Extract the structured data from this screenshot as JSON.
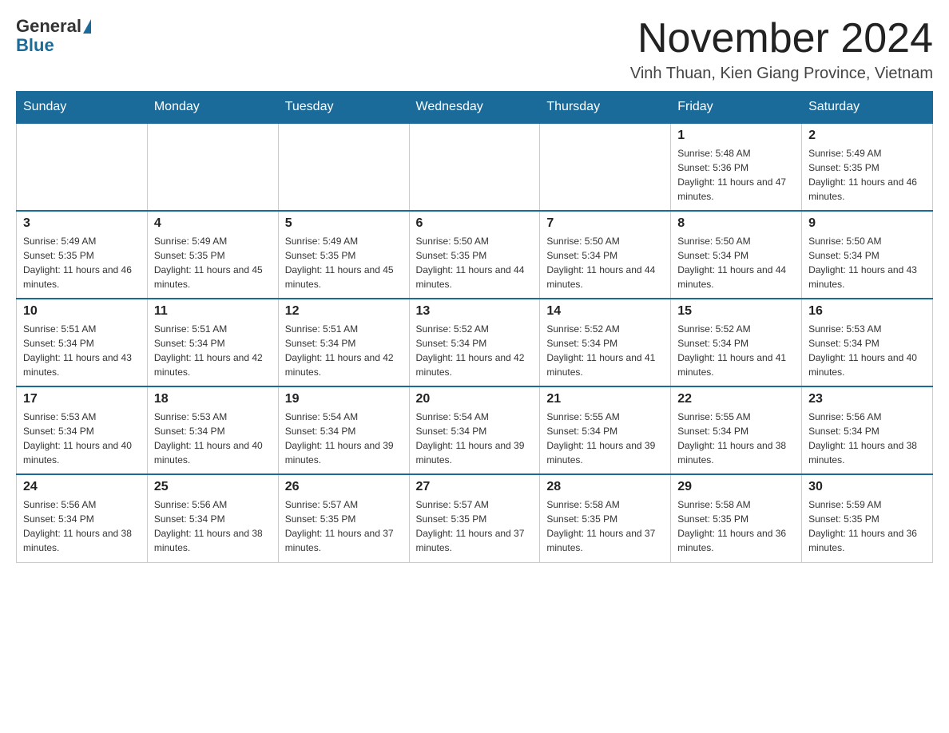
{
  "header": {
    "logo_general": "General",
    "logo_blue": "Blue",
    "title": "November 2024",
    "subtitle": "Vinh Thuan, Kien Giang Province, Vietnam"
  },
  "days_of_week": [
    "Sunday",
    "Monday",
    "Tuesday",
    "Wednesday",
    "Thursday",
    "Friday",
    "Saturday"
  ],
  "weeks": [
    [
      {
        "day": "",
        "info": ""
      },
      {
        "day": "",
        "info": ""
      },
      {
        "day": "",
        "info": ""
      },
      {
        "day": "",
        "info": ""
      },
      {
        "day": "",
        "info": ""
      },
      {
        "day": "1",
        "info": "Sunrise: 5:48 AM\nSunset: 5:36 PM\nDaylight: 11 hours and 47 minutes."
      },
      {
        "day": "2",
        "info": "Sunrise: 5:49 AM\nSunset: 5:35 PM\nDaylight: 11 hours and 46 minutes."
      }
    ],
    [
      {
        "day": "3",
        "info": "Sunrise: 5:49 AM\nSunset: 5:35 PM\nDaylight: 11 hours and 46 minutes."
      },
      {
        "day": "4",
        "info": "Sunrise: 5:49 AM\nSunset: 5:35 PM\nDaylight: 11 hours and 45 minutes."
      },
      {
        "day": "5",
        "info": "Sunrise: 5:49 AM\nSunset: 5:35 PM\nDaylight: 11 hours and 45 minutes."
      },
      {
        "day": "6",
        "info": "Sunrise: 5:50 AM\nSunset: 5:35 PM\nDaylight: 11 hours and 44 minutes."
      },
      {
        "day": "7",
        "info": "Sunrise: 5:50 AM\nSunset: 5:34 PM\nDaylight: 11 hours and 44 minutes."
      },
      {
        "day": "8",
        "info": "Sunrise: 5:50 AM\nSunset: 5:34 PM\nDaylight: 11 hours and 44 minutes."
      },
      {
        "day": "9",
        "info": "Sunrise: 5:50 AM\nSunset: 5:34 PM\nDaylight: 11 hours and 43 minutes."
      }
    ],
    [
      {
        "day": "10",
        "info": "Sunrise: 5:51 AM\nSunset: 5:34 PM\nDaylight: 11 hours and 43 minutes."
      },
      {
        "day": "11",
        "info": "Sunrise: 5:51 AM\nSunset: 5:34 PM\nDaylight: 11 hours and 42 minutes."
      },
      {
        "day": "12",
        "info": "Sunrise: 5:51 AM\nSunset: 5:34 PM\nDaylight: 11 hours and 42 minutes."
      },
      {
        "day": "13",
        "info": "Sunrise: 5:52 AM\nSunset: 5:34 PM\nDaylight: 11 hours and 42 minutes."
      },
      {
        "day": "14",
        "info": "Sunrise: 5:52 AM\nSunset: 5:34 PM\nDaylight: 11 hours and 41 minutes."
      },
      {
        "day": "15",
        "info": "Sunrise: 5:52 AM\nSunset: 5:34 PM\nDaylight: 11 hours and 41 minutes."
      },
      {
        "day": "16",
        "info": "Sunrise: 5:53 AM\nSunset: 5:34 PM\nDaylight: 11 hours and 40 minutes."
      }
    ],
    [
      {
        "day": "17",
        "info": "Sunrise: 5:53 AM\nSunset: 5:34 PM\nDaylight: 11 hours and 40 minutes."
      },
      {
        "day": "18",
        "info": "Sunrise: 5:53 AM\nSunset: 5:34 PM\nDaylight: 11 hours and 40 minutes."
      },
      {
        "day": "19",
        "info": "Sunrise: 5:54 AM\nSunset: 5:34 PM\nDaylight: 11 hours and 39 minutes."
      },
      {
        "day": "20",
        "info": "Sunrise: 5:54 AM\nSunset: 5:34 PM\nDaylight: 11 hours and 39 minutes."
      },
      {
        "day": "21",
        "info": "Sunrise: 5:55 AM\nSunset: 5:34 PM\nDaylight: 11 hours and 39 minutes."
      },
      {
        "day": "22",
        "info": "Sunrise: 5:55 AM\nSunset: 5:34 PM\nDaylight: 11 hours and 38 minutes."
      },
      {
        "day": "23",
        "info": "Sunrise: 5:56 AM\nSunset: 5:34 PM\nDaylight: 11 hours and 38 minutes."
      }
    ],
    [
      {
        "day": "24",
        "info": "Sunrise: 5:56 AM\nSunset: 5:34 PM\nDaylight: 11 hours and 38 minutes."
      },
      {
        "day": "25",
        "info": "Sunrise: 5:56 AM\nSunset: 5:34 PM\nDaylight: 11 hours and 38 minutes."
      },
      {
        "day": "26",
        "info": "Sunrise: 5:57 AM\nSunset: 5:35 PM\nDaylight: 11 hours and 37 minutes."
      },
      {
        "day": "27",
        "info": "Sunrise: 5:57 AM\nSunset: 5:35 PM\nDaylight: 11 hours and 37 minutes."
      },
      {
        "day": "28",
        "info": "Sunrise: 5:58 AM\nSunset: 5:35 PM\nDaylight: 11 hours and 37 minutes."
      },
      {
        "day": "29",
        "info": "Sunrise: 5:58 AM\nSunset: 5:35 PM\nDaylight: 11 hours and 36 minutes."
      },
      {
        "day": "30",
        "info": "Sunrise: 5:59 AM\nSunset: 5:35 PM\nDaylight: 11 hours and 36 minutes."
      }
    ]
  ]
}
